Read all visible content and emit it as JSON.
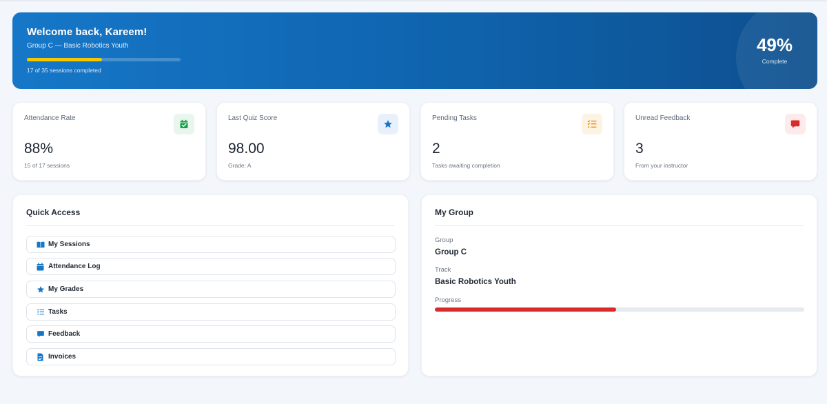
{
  "hero": {
    "welcome": "Welcome back, Kareem!",
    "subtitle": "Group C — Basic Robotics Youth",
    "progress_fraction": 0.49,
    "sessions_text": "17 of 35 sessions completed",
    "percent": "49%",
    "percent_label": "Complete",
    "colors": {
      "bar": "#f4c900",
      "banner_start": "#1677c8",
      "banner_end": "#0d4f8e"
    }
  },
  "stats": [
    {
      "label": "Attendance Rate",
      "value": "88%",
      "note": "15 of 17 sessions",
      "icon": "calendar-check-icon",
      "icon_color": "#1e9e4a",
      "icon_bg": "#e8f6ee"
    },
    {
      "label": "Last Quiz Score",
      "value": "98.00",
      "note": "Grade: A",
      "icon": "star-icon",
      "icon_color": "#1677c8",
      "icon_bg": "#e8f1fb"
    },
    {
      "label": "Pending Tasks",
      "value": "2",
      "note": "Tasks awaiting completion",
      "icon": "task-list-icon",
      "icon_color": "#e08a0c",
      "icon_bg": "#fdf3e2"
    },
    {
      "label": "Unread Feedback",
      "value": "3",
      "note": "From your instructor",
      "icon": "comment-icon",
      "icon_color": "#d92b2b",
      "icon_bg": "#fdeaea"
    }
  ],
  "quick_access": {
    "title": "Quick Access",
    "items": [
      {
        "label": "My Sessions",
        "icon": "book-open-icon"
      },
      {
        "label": "Attendance Log",
        "icon": "calendar-icon"
      },
      {
        "label": "My Grades",
        "icon": "star-icon"
      },
      {
        "label": "Tasks",
        "icon": "task-list-icon"
      },
      {
        "label": "Feedback",
        "icon": "comment-icon"
      },
      {
        "label": "Invoices",
        "icon": "file-invoice-icon"
      }
    ],
    "icon_color": "#1677c8"
  },
  "my_group": {
    "title": "My Group",
    "group_label": "Group",
    "group_value": "Group C",
    "track_label": "Track",
    "track_value": "Basic Robotics Youth",
    "progress_label": "Progress",
    "progress_fraction": 0.49,
    "progress_color": "#d92b2b"
  }
}
